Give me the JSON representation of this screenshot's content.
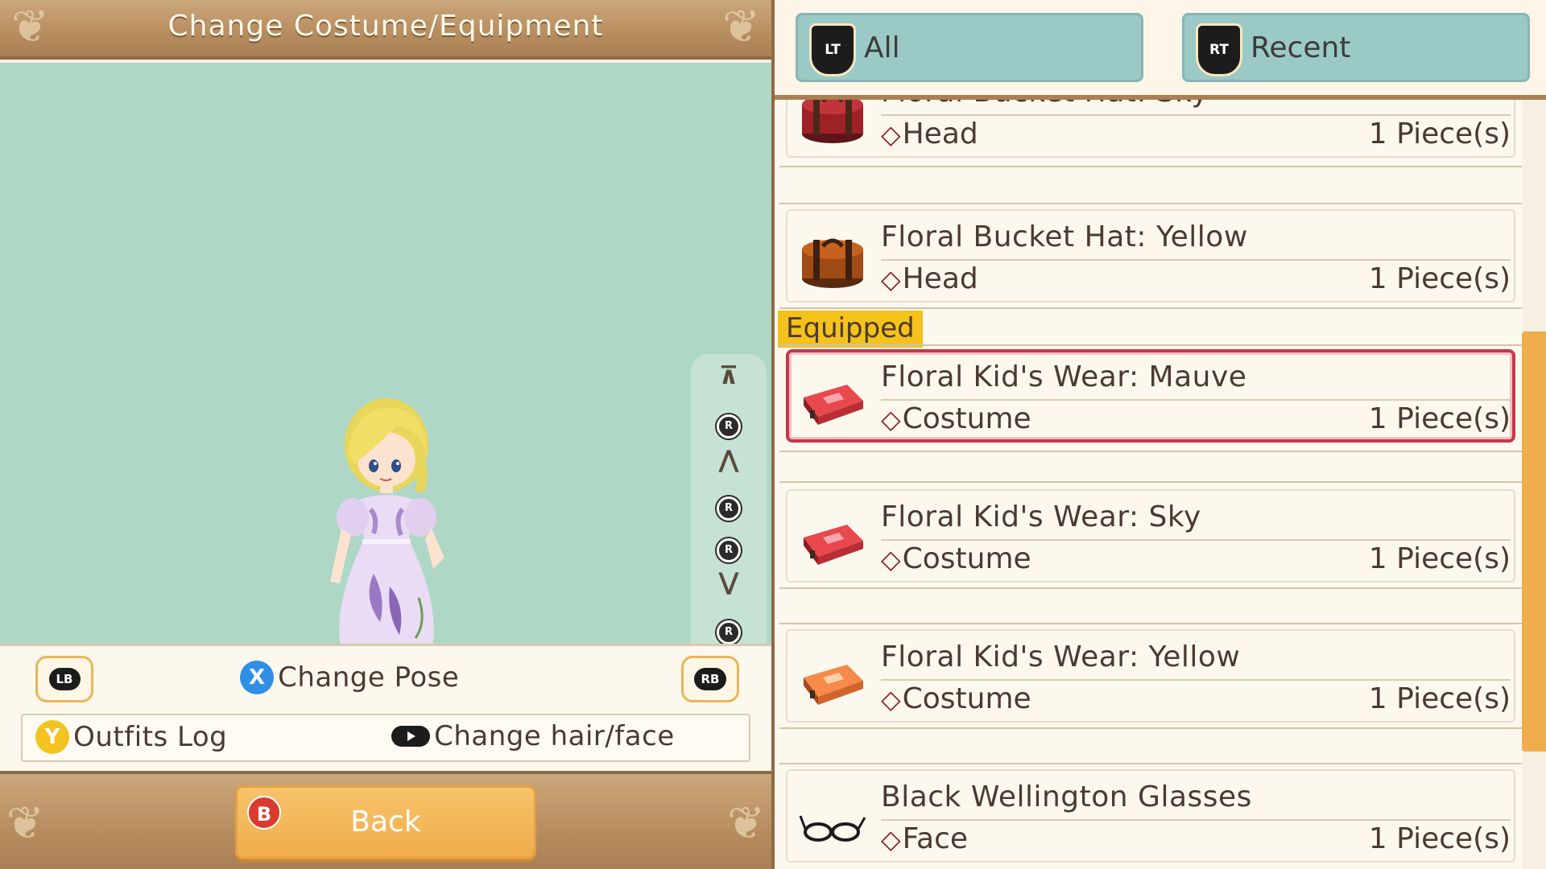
{
  "window": {
    "title": "Change Costume/Equipment"
  },
  "camera_controls": {
    "icons": [
      "top-icon",
      "r-stick-up-icon",
      "zoom-in-icon",
      "r-stick-left-icon",
      "r-stick-right-icon",
      "zoom-out-icon",
      "r-stick-down-icon",
      "bottom-icon"
    ],
    "r_label": "R"
  },
  "controls": {
    "lb_label": "LB",
    "rb_label": "RB",
    "pose_button": "X",
    "pose_label": "Change Pose",
    "outfits_button": "Y",
    "outfits_label": "Outfits Log",
    "hairface_label": "Change hair/face"
  },
  "footer": {
    "back_button": "B",
    "back_label": "Back"
  },
  "tabs": [
    {
      "badge": "LT",
      "label": "All"
    },
    {
      "badge": "RT",
      "label": "Recent"
    }
  ],
  "equipped_label": "Equipped",
  "items": [
    {
      "name": "Floral Bucket Hat: Sky",
      "slot": "Head",
      "qty": "1 Piece(s)",
      "icon": "hatbox-red-icon"
    },
    {
      "name": "Floral Bucket Hat: Yellow",
      "slot": "Head",
      "qty": "1 Piece(s)",
      "icon": "hatbox-brown-icon"
    },
    {
      "name": "Floral Kid's Wear: Mauve",
      "slot": "Costume",
      "qty": "1 Piece(s)",
      "icon": "costume-case-red-icon",
      "equipped": true
    },
    {
      "name": "Floral Kid's Wear: Sky",
      "slot": "Costume",
      "qty": "1 Piece(s)",
      "icon": "costume-case-red-icon"
    },
    {
      "name": "Floral Kid's Wear: Yellow",
      "slot": "Costume",
      "qty": "1 Piece(s)",
      "icon": "costume-case-orange-icon"
    },
    {
      "name": "Black Wellington Glasses",
      "slot": "Face",
      "qty": "1 Piece(s)",
      "icon": "glasses-icon"
    }
  ],
  "colors": {
    "accent_orange": "#f0ad4c",
    "equipped_tag": "#f5c21b",
    "selected_border": "#c7364a",
    "tab_bg": "#9bc9c6",
    "viewport_bg": "#aed7c5"
  }
}
